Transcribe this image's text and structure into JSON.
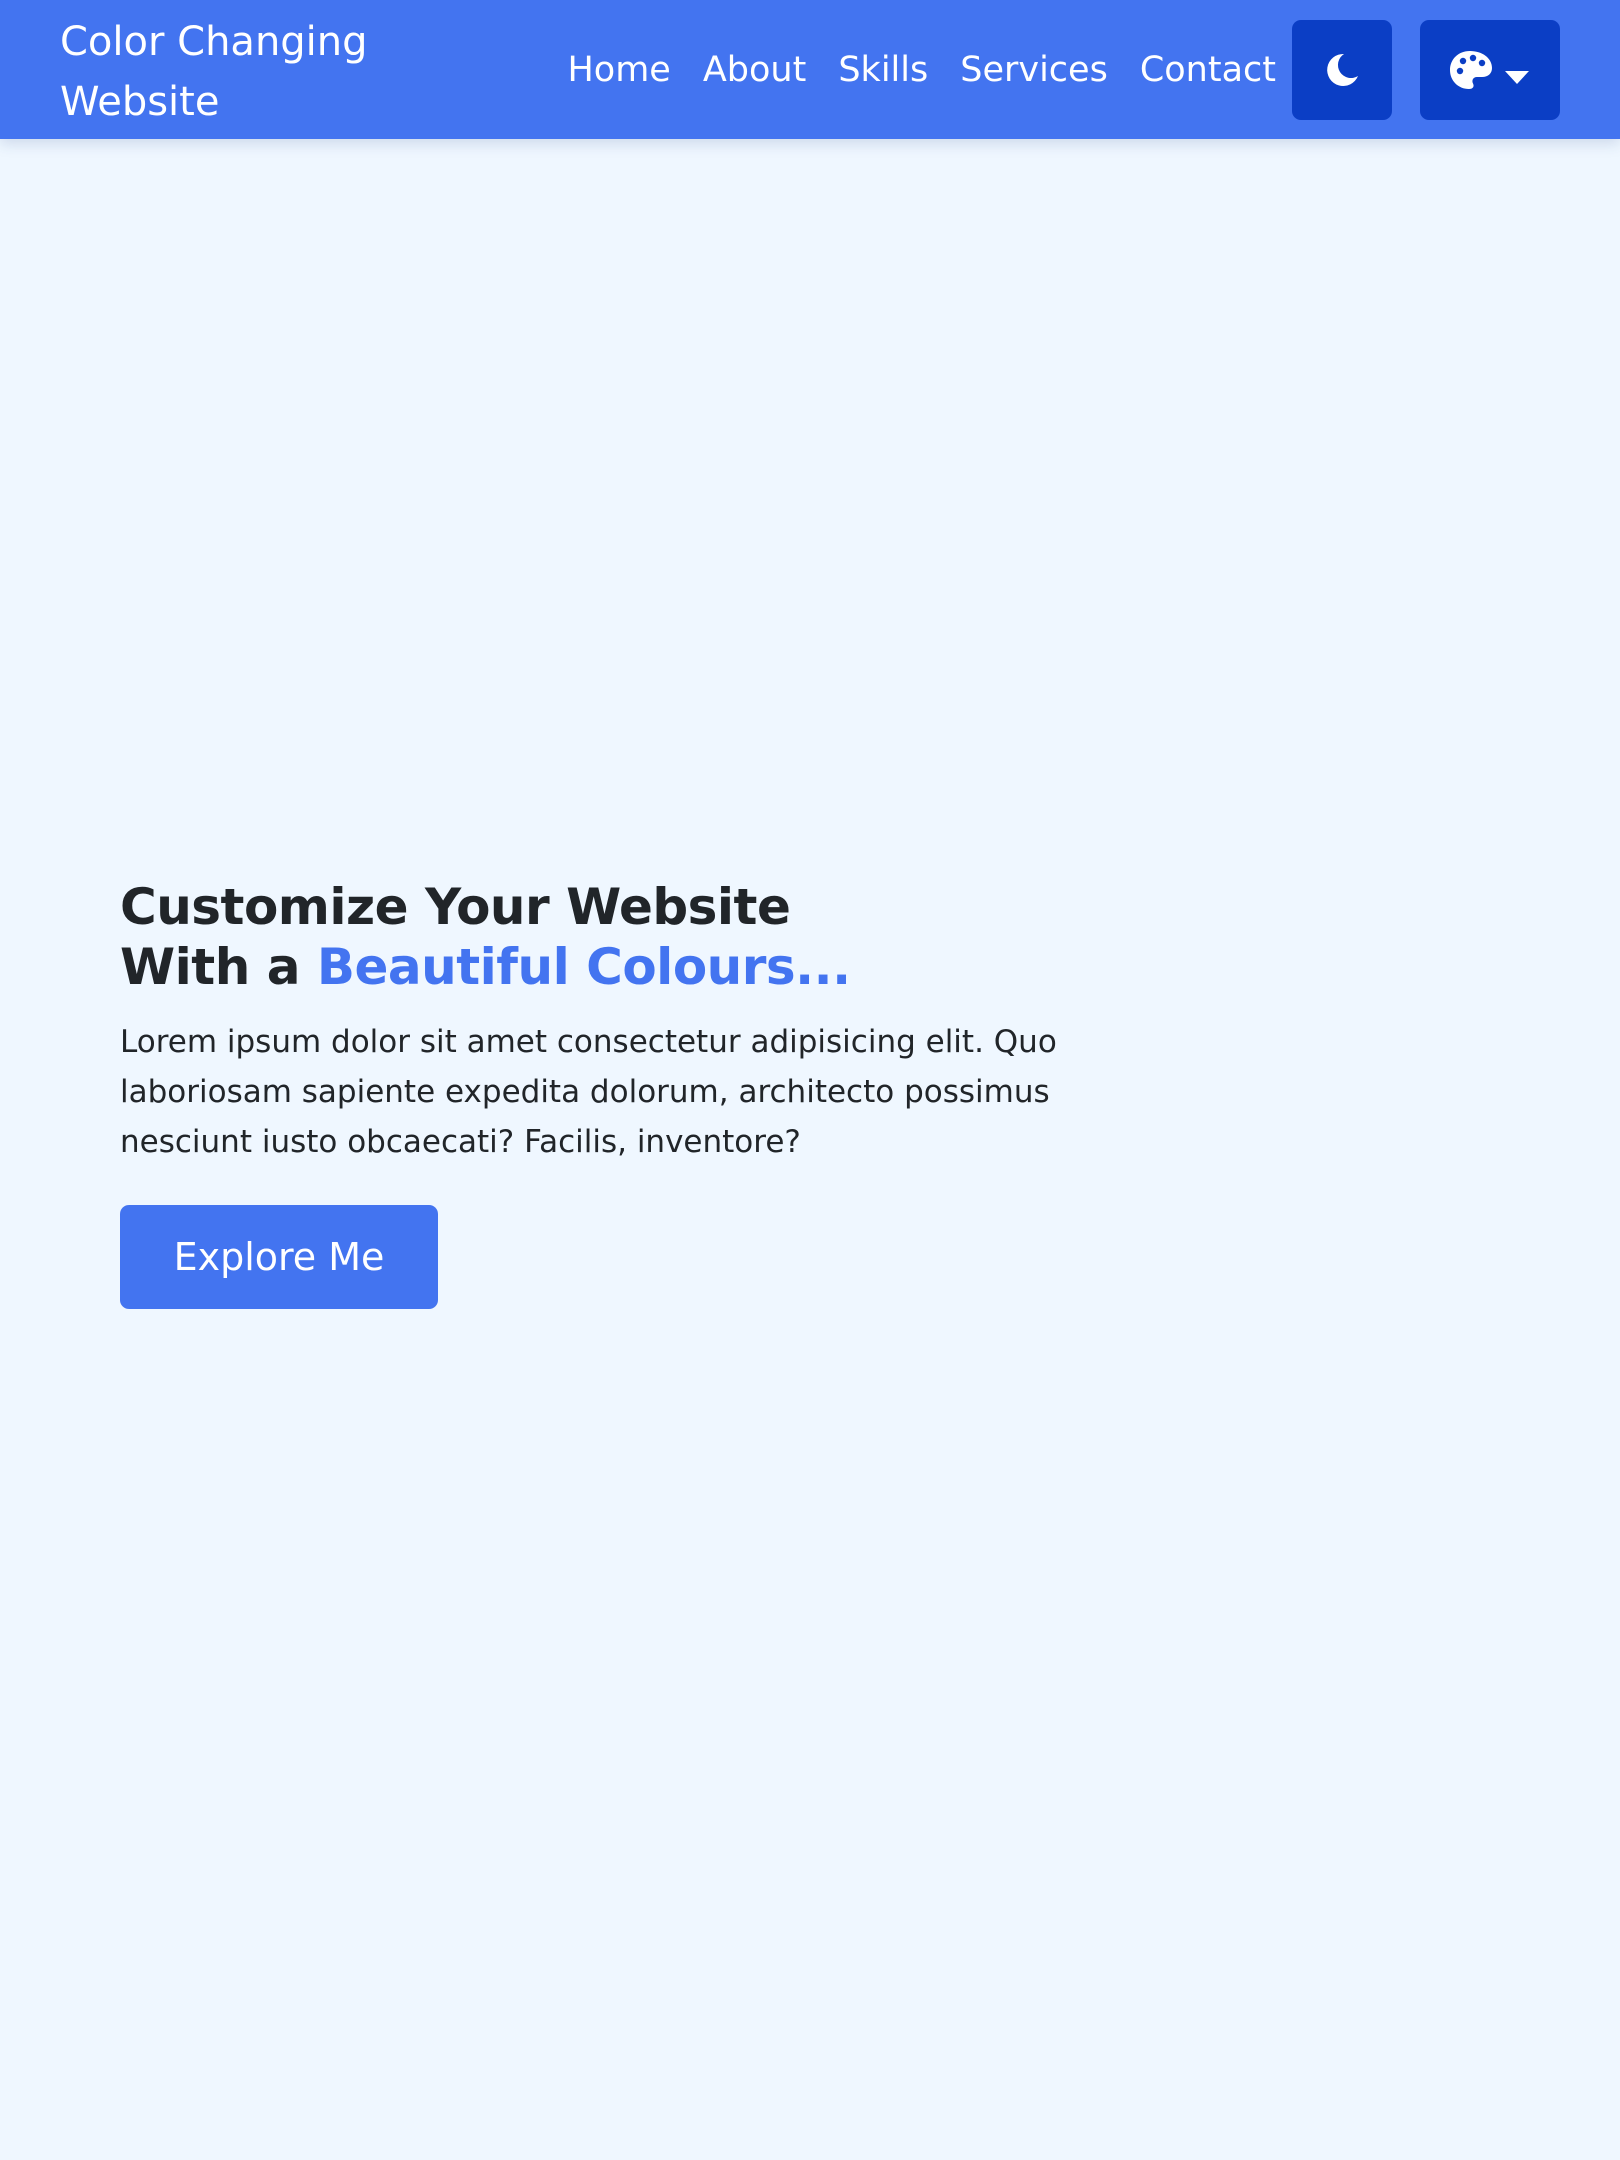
{
  "navbar": {
    "brand_line1": "Color Changing",
    "brand_line2": "Website",
    "links": [
      {
        "label": "Home"
      },
      {
        "label": "About"
      },
      {
        "label": "Skills"
      },
      {
        "label": "Services"
      },
      {
        "label": "Contact"
      }
    ],
    "dark_mode_icon": "moon-icon",
    "palette_icon": "palette-icon",
    "dropdown_icon": "caret-down-icon"
  },
  "hero": {
    "title_line1": "Customize Your Website",
    "title_line2_prefix": "With a ",
    "title_line2_accent": "Beautiful Colours...",
    "description": "Lorem ipsum dolor sit amet consectetur adipisicing elit. Quo laboriosam sapiente expedita dolorum, architecto possimus nesciunt iusto obcaecati? Facilis, inventore?",
    "cta_label": "Explore Me"
  },
  "colors": {
    "primary": "#4374f0",
    "primary_dark": "#0b3ec5",
    "background": "#eff7ff",
    "text": "#212529"
  }
}
